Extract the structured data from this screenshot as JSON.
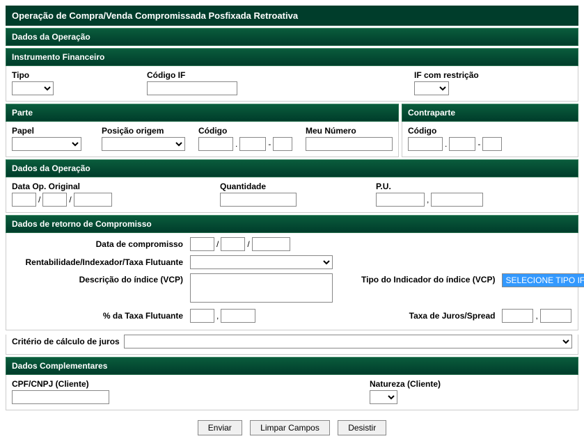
{
  "title": "Operação de Compra/Venda Compromissada Posfixada Retroativa",
  "sections": {
    "dados_operacao_top": "Dados da Operação",
    "instrumento": "Instrumento Financeiro",
    "parte": "Parte",
    "contraparte": "Contraparte",
    "dados_operacao_mid": "Dados da Operação",
    "retorno": "Dados de retorno de Compromisso",
    "complementares": "Dados Complementares"
  },
  "instrumento": {
    "tipo_label": "Tipo",
    "codigo_if_label": "Código IF",
    "if_restricao_label": "IF com restrição"
  },
  "parte": {
    "papel_label": "Papel",
    "posicao_origem_label": "Posição origem",
    "codigo_label": "Código",
    "meu_numero_label": "Meu Número"
  },
  "contraparte": {
    "codigo_label": "Código"
  },
  "operacao": {
    "data_op_label": "Data Op. Original",
    "quantidade_label": "Quantidade",
    "pu_label": "P.U."
  },
  "retorno": {
    "data_comp_label": "Data de compromisso",
    "rentabilidade_label": "Rentabilidade/Indexador/Taxa Flutuante",
    "descricao_label": "Descrição do índice (VCP)",
    "tipo_indicador_label": "Tipo do Indicador do índice (VCP)",
    "tipo_indicador_value": "SELECIONE TIPO IF",
    "pct_taxa_label": "% da Taxa Flutuante",
    "taxa_juros_label": "Taxa de Juros/Spread",
    "criterio_label": "Critério de cálculo de juros"
  },
  "complementares": {
    "cpf_label": "CPF/CNPJ (Cliente)",
    "natureza_label": "Natureza (Cliente)"
  },
  "buttons": {
    "enviar": "Enviar",
    "limpar": "Limpar Campos",
    "desistir": "Desistir"
  },
  "sep": {
    "slash": "/",
    "dot": ".",
    "dash": "-",
    "comma": ","
  }
}
